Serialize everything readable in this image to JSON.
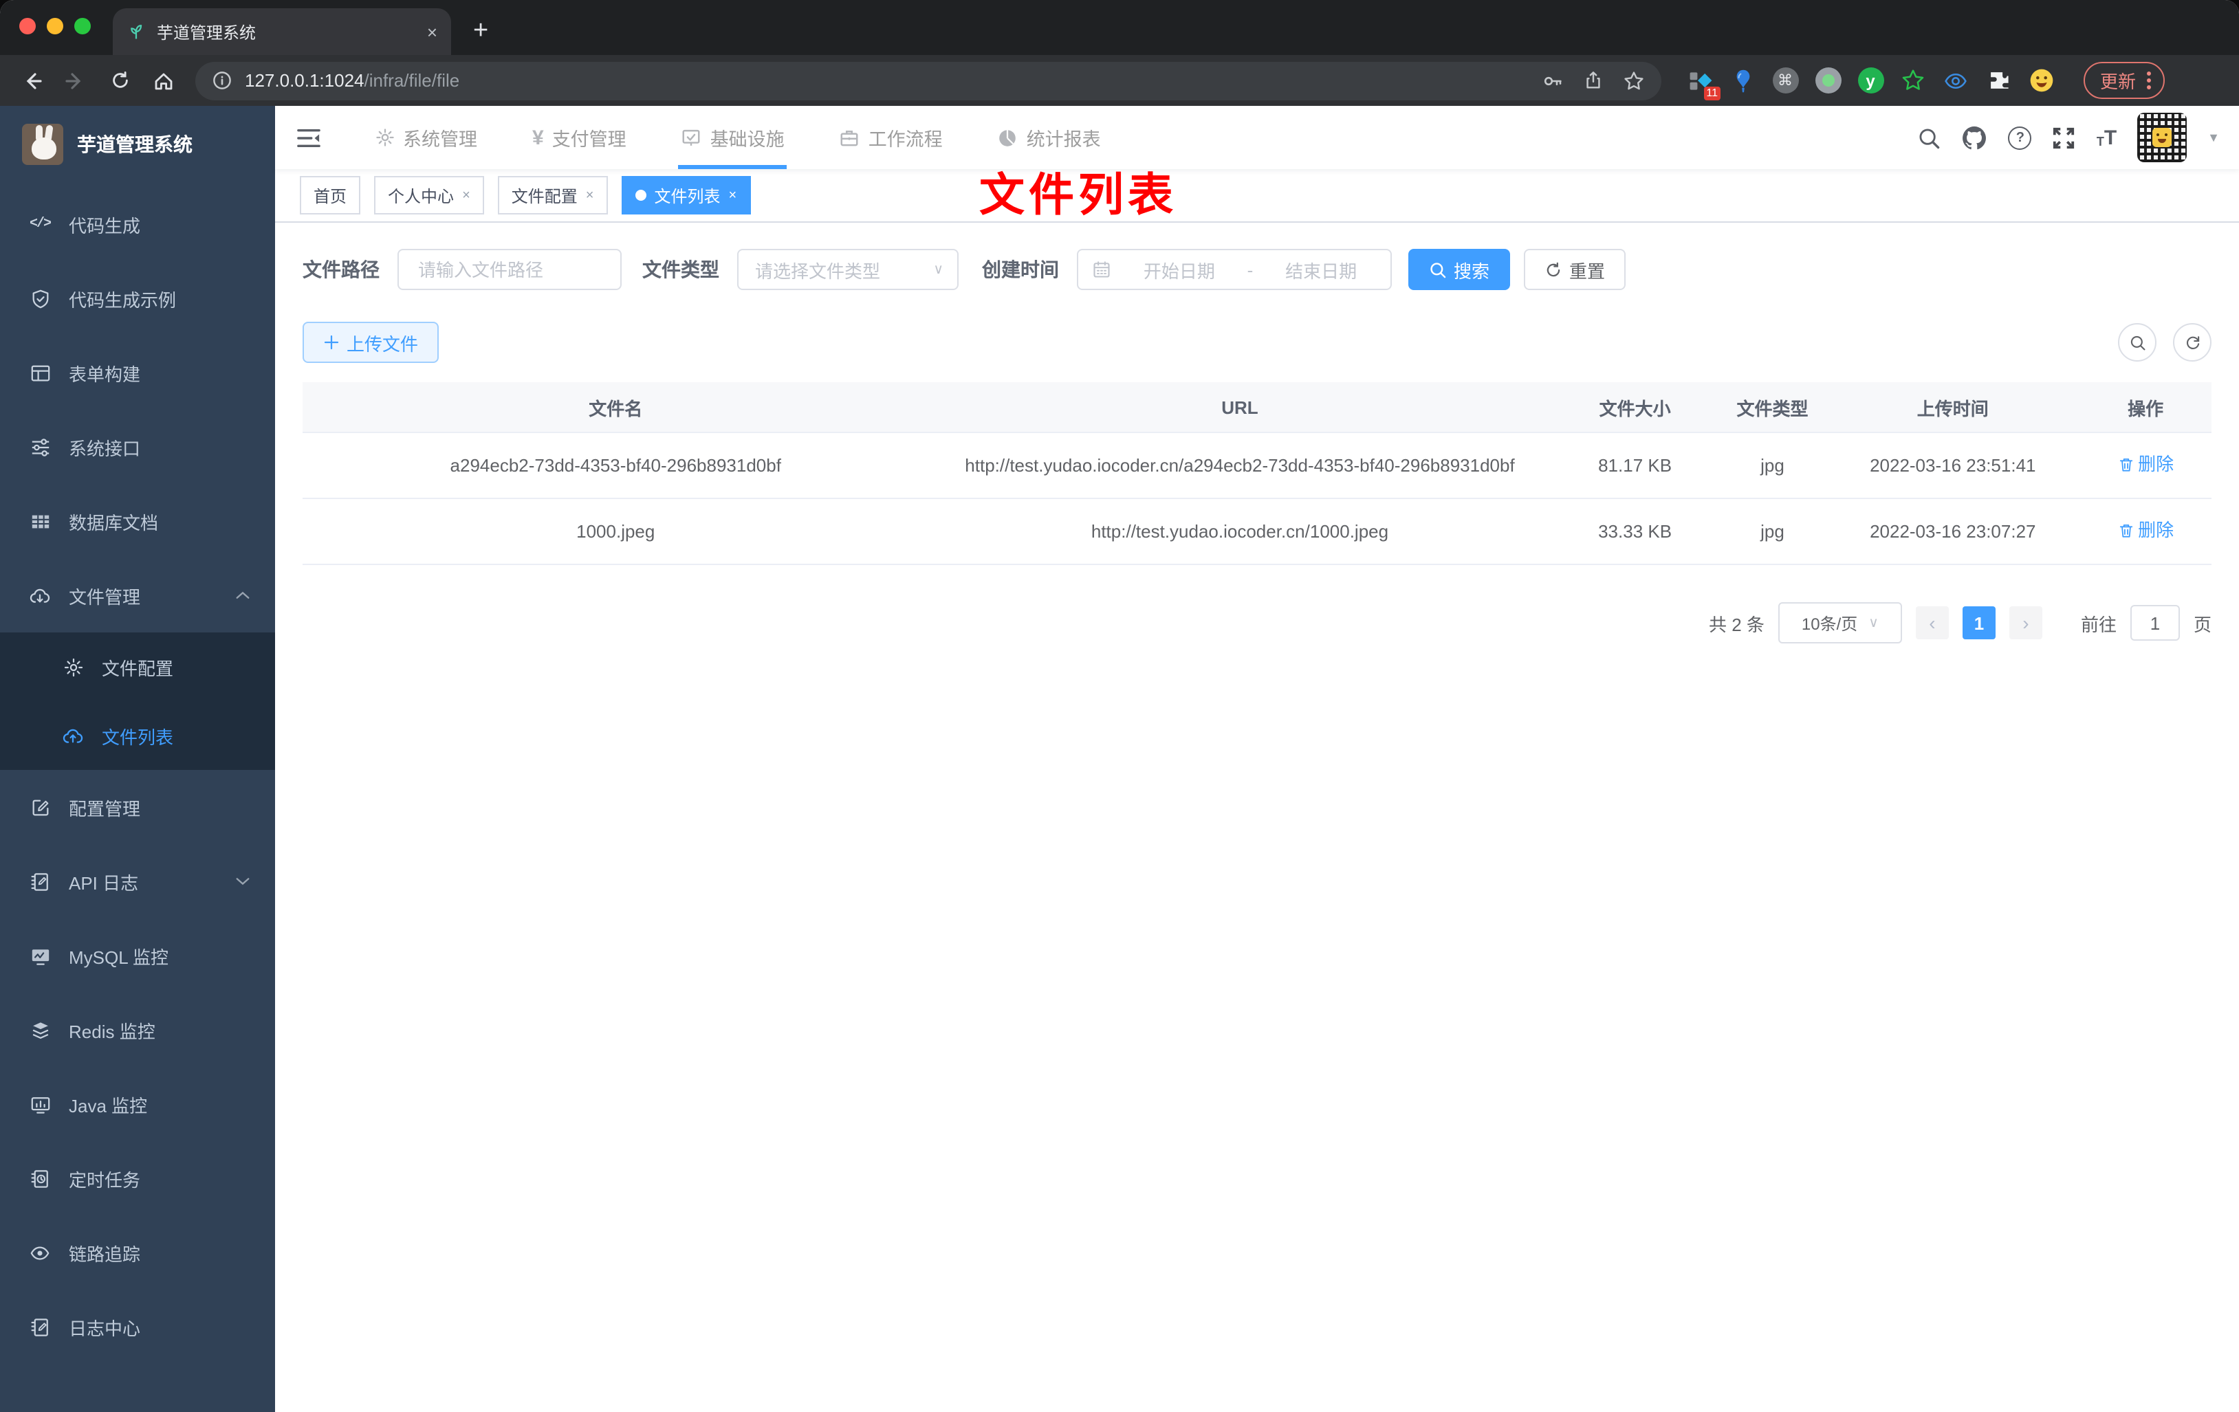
{
  "browser": {
    "tab_title": "芋道管理系统",
    "close_tab": "×",
    "new_tab": "+",
    "url_host": "127.0.0.1:1024",
    "url_path": "/infra/file/file",
    "ext_badge": "11",
    "cmd_glyph": "⌘",
    "y_glyph": "y",
    "update_button": "更新"
  },
  "topnav": {
    "menus": [
      {
        "label": "系统管理"
      },
      {
        "label": "支付管理"
      },
      {
        "label": "基础设施"
      },
      {
        "label": "工作流程"
      },
      {
        "label": "统计报表"
      }
    ],
    "yen_glyph": "¥"
  },
  "sidebar": {
    "title": "芋道管理系统",
    "code_glyph": "</>",
    "items": [
      {
        "label": "代码生成"
      },
      {
        "label": "代码生成示例"
      },
      {
        "label": "表单构建"
      },
      {
        "label": "系统接口"
      },
      {
        "label": "数据库文档"
      },
      {
        "label": "文件管理"
      },
      {
        "label": "配置管理"
      },
      {
        "label": "API 日志"
      },
      {
        "label": "MySQL 监控"
      },
      {
        "label": "Redis 监控"
      },
      {
        "label": "Java 监控"
      },
      {
        "label": "定时任务"
      },
      {
        "label": "链路追踪"
      },
      {
        "label": "日志中心"
      }
    ],
    "file_children": [
      {
        "label": "文件配置"
      },
      {
        "label": "文件列表"
      }
    ]
  },
  "tabs": {
    "items": [
      {
        "label": "首页"
      },
      {
        "label": "个人中心"
      },
      {
        "label": "文件配置"
      },
      {
        "label": "文件列表"
      }
    ],
    "close_glyph": "×"
  },
  "annotation": "文件列表",
  "filters": {
    "path_label": "文件路径",
    "path_placeholder": "请输入文件路径",
    "type_label": "文件类型",
    "type_placeholder": "请选择文件类型",
    "date_label": "创建时间",
    "date_start": "开始日期",
    "date_sep": "-",
    "date_end": "结束日期",
    "search": "搜索",
    "reset": "重置"
  },
  "toolbar": {
    "upload": "上传文件"
  },
  "table": {
    "columns": [
      "文件名",
      "URL",
      "文件大小",
      "文件类型",
      "上传时间",
      "操作"
    ],
    "rows": [
      {
        "name": "a294ecb2-73dd-4353-bf40-296b8931d0bf",
        "url": "http://test.yudao.iocoder.cn/a294ecb2-73dd-4353-bf40-296b8931d0bf",
        "size": "81.17 KB",
        "type": "jpg",
        "time": "2022-03-16 23:51:41",
        "action": "删除"
      },
      {
        "name": "1000.jpeg",
        "url": "http://test.yudao.iocoder.cn/1000.jpeg",
        "size": "33.33 KB",
        "type": "jpg",
        "time": "2022-03-16 23:07:27",
        "action": "删除"
      }
    ]
  },
  "pagination": {
    "total": "共 2 条",
    "page_size": "10条/页",
    "prev": "‹",
    "next": "›",
    "page": "1",
    "goto_label": "前往",
    "goto_value": "1",
    "page_unit": "页"
  },
  "colors": {
    "accent": "#409eff",
    "annotation_red": "#ff0000",
    "sidebar_bg": "#304156",
    "submenu_bg": "#1f2d3d"
  }
}
